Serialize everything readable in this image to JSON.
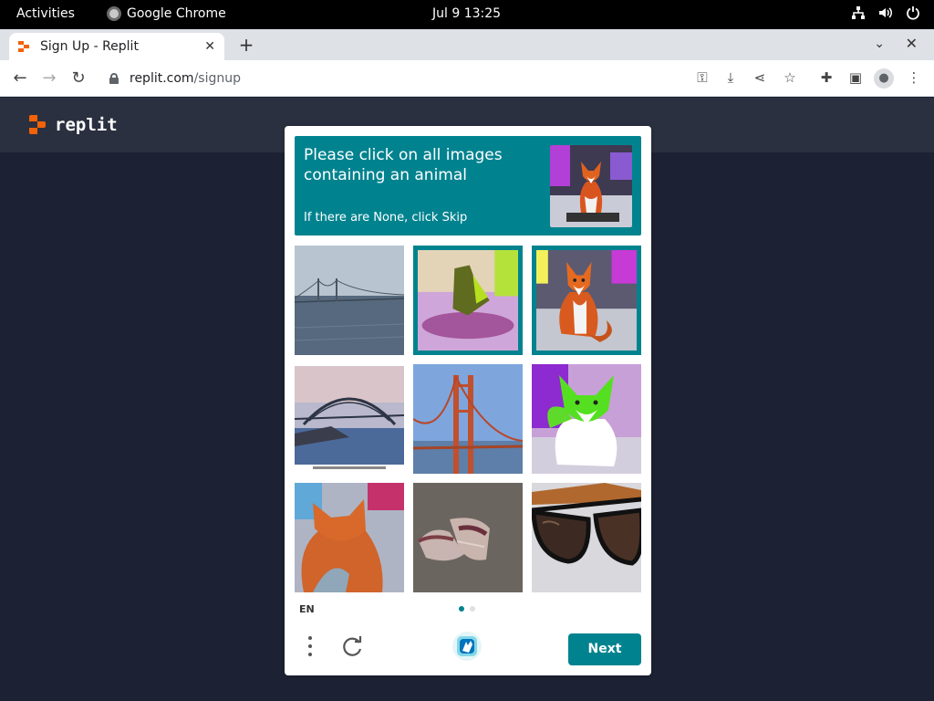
{
  "system_bar": {
    "activities": "Activities",
    "app_name": "Google Chrome",
    "clock": "Jul 9  13:25"
  },
  "browser": {
    "tab_title": "Sign Up - Replit",
    "url_host": "replit.com",
    "url_path": "/signup"
  },
  "replit": {
    "logo_text": "replit",
    "brand_color": "#f26207"
  },
  "captcha": {
    "prompt": "Please click on all images containing an animal",
    "hint": "If there are None, click Skip",
    "language": "EN",
    "next_label": "Next",
    "accent_color": "#00838f",
    "pages": 2,
    "current_page": 1,
    "tiles": [
      {
        "subject": "bridge over water",
        "selected": false
      },
      {
        "subject": "green object on purple background",
        "selected": true
      },
      {
        "subject": "fox",
        "selected": true
      },
      {
        "subject": "arch bridge",
        "selected": false
      },
      {
        "subject": "suspension bridge",
        "selected": false
      },
      {
        "subject": "green fox",
        "selected": false
      },
      {
        "subject": "fox close-up",
        "selected": false
      },
      {
        "subject": "sneakers",
        "selected": false
      },
      {
        "subject": "sunglasses",
        "selected": false
      }
    ]
  }
}
